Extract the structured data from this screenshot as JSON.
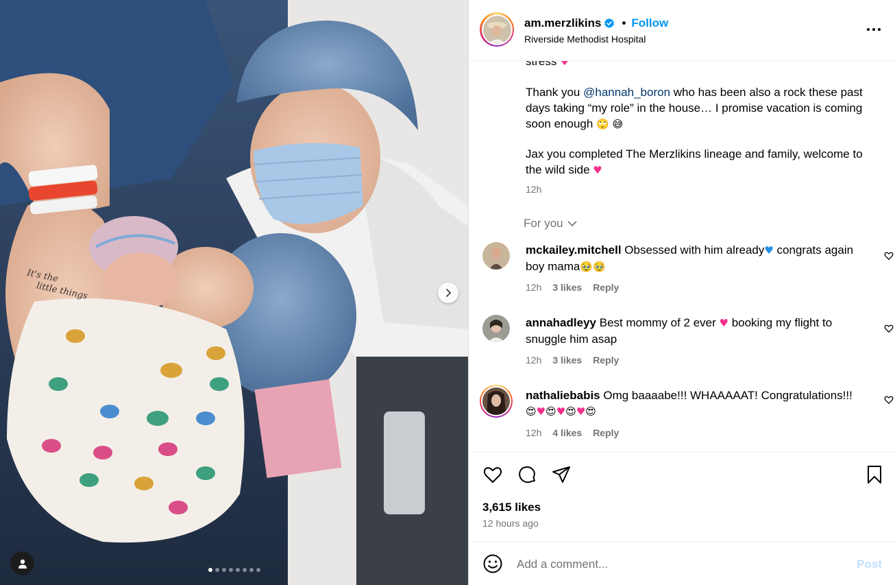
{
  "photo": {
    "carousel_count": 8,
    "carousel_active": 0,
    "tattoo_text": "It's the little things"
  },
  "header": {
    "username": "am.merzlikins",
    "verified": true,
    "dot": "•",
    "follow_label": "Follow",
    "location": "Riverside Methodist Hospital"
  },
  "caption": {
    "line_top": "stress",
    "thanks_pre": "Thank you ",
    "thanks_mention": "@hannah_boron",
    "thanks_post": " who has been also a rock these past days taking “my role” in the house… I promise vacation is coming soon enough",
    "jax": "Jax you completed The Merzlikins lineage and family, welcome to the wild side",
    "time": "12h"
  },
  "for_you_label": "For you",
  "comments": [
    {
      "user": "mckailey.mitchell",
      "text_a": "Obsessed with him already",
      "text_b": " congrats again boy mama",
      "time": "12h",
      "likes": "3 likes",
      "reply": "Reply"
    },
    {
      "user": "annahadleyy",
      "text_a": "Best mommy of 2 ever ",
      "text_b": " booking my flight to snuggle him asap",
      "time": "12h",
      "likes": "3 likes",
      "reply": "Reply"
    },
    {
      "user": "nathaliebabis",
      "text_a": "Omg baaaabe!!! WHAAAAAT! Congratulations!!!",
      "time": "12h",
      "likes": "4 likes",
      "reply": "Reply"
    }
  ],
  "actions": {
    "likes": "3,615 likes",
    "time_ago": "12 hours ago"
  },
  "add_comment": {
    "placeholder": "Add a comment...",
    "post_label": "Post"
  },
  "icons": {
    "verified": "verified-badge-icon",
    "more": "more-options-icon",
    "like": "heart-icon",
    "comment": "comment-icon",
    "share": "share-icon",
    "save": "bookmark-icon",
    "emoji": "emoji-icon",
    "next": "chevron-right-icon",
    "tag": "user-tag-icon"
  },
  "colors": {
    "link_blue": "#0095f6",
    "mention": "#00376b",
    "secondary": "#737373",
    "heart_pink": "#f0308a"
  }
}
